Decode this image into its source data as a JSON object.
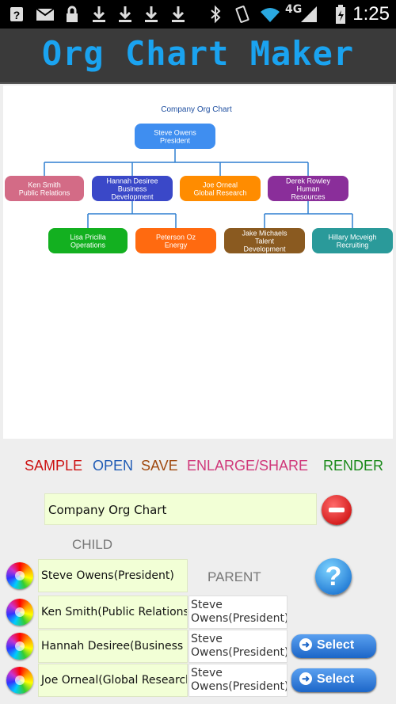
{
  "app": {
    "title": "Org Chart Maker"
  },
  "status": {
    "time": "1:25",
    "network": "4G"
  },
  "chart": {
    "title": "Company Org Chart",
    "nodes": [
      {
        "id": "n0",
        "lines": [
          "Steve Owens",
          "President"
        ],
        "color": "#3f8ef0"
      },
      {
        "id": "n1",
        "lines": [
          "Ken Smith",
          "Public Relations"
        ],
        "color": "#d36b86"
      },
      {
        "id": "n2",
        "lines": [
          "Hannah Desiree",
          "Business",
          "Development"
        ],
        "color": "#3a48c8"
      },
      {
        "id": "n3",
        "lines": [
          "Joe Orneal",
          "Global Research"
        ],
        "color": "#ff8c00"
      },
      {
        "id": "n4",
        "lines": [
          "Derek Rowley",
          "Human",
          "Resources"
        ],
        "color": "#8a2e9a"
      },
      {
        "id": "n5",
        "lines": [
          "Lisa Pricilla",
          "Operations"
        ],
        "color": "#13b020"
      },
      {
        "id": "n6",
        "lines": [
          "Peterson Oz",
          "Energy"
        ],
        "color": "#ff6a10"
      },
      {
        "id": "n7",
        "lines": [
          "Jake Michaels",
          "Talent",
          "Development"
        ],
        "color": "#8a5a20"
      },
      {
        "id": "n8",
        "lines": [
          "Hillary Mcveigh",
          "Recruiting"
        ],
        "color": "#2a9a9a"
      }
    ]
  },
  "toolbar": {
    "sample": "SAMPLE",
    "open": "OPEN",
    "save": "SAVE",
    "enlarge": "ENLARGE/SHARE",
    "render": "RENDER",
    "colors": {
      "sample": "#cc1111",
      "open": "#1f5bb5",
      "save": "#a04a10",
      "enlarge": "#d0387a",
      "render": "#1a8a1a"
    }
  },
  "form": {
    "chart_name": "Company Org Chart",
    "child_header": "CHILD",
    "parent_header": "PARENT",
    "select_label": "Select",
    "rows": [
      {
        "child": "Steve Owens(President)",
        "parent": "",
        "has_select": false
      },
      {
        "child": "Ken Smith(Public Relations)",
        "parent": "Steve Owens(President)",
        "has_select": false
      },
      {
        "child": "Hannah Desiree(Business Development)",
        "parent": "Steve Owens(President)",
        "has_select": true
      },
      {
        "child": "Joe Orneal(Global Research)",
        "parent": "Steve Owens(President)",
        "has_select": true
      }
    ]
  }
}
